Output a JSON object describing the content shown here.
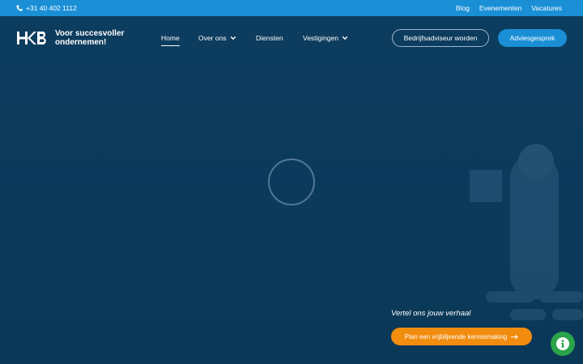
{
  "topbar": {
    "phone": "+31 40 402 1112",
    "links": [
      "Blog",
      "Evenementen",
      "Vacatures"
    ]
  },
  "header": {
    "logo_text_line1": "Voor succesvoller",
    "logo_text_line2": "ondernemen!",
    "nav": [
      {
        "label": "Home",
        "active": true,
        "dropdown": false
      },
      {
        "label": "Over ons",
        "active": false,
        "dropdown": true
      },
      {
        "label": "Diensten",
        "active": false,
        "dropdown": false
      },
      {
        "label": "Vestigingen",
        "active": false,
        "dropdown": true
      }
    ],
    "secondary_button": "Bedrijfsadviseur worden",
    "primary_button": "Adviesgesprek"
  },
  "hero": {
    "cta_title": "Vertel ons jouw verhaal",
    "cta_button": "Plan een vrijblijvende kennismaking"
  },
  "icons": {
    "phone": "phone-icon",
    "chevron": "chevron-down-icon",
    "arrow": "arrow-right-icon",
    "info": "info-icon"
  },
  "colors": {
    "topbar": "#1a8fd6",
    "background": "#0c3a5a",
    "primary": "#1a8fd6",
    "cta": "#f28c0f",
    "fab": "#2ca44a"
  }
}
